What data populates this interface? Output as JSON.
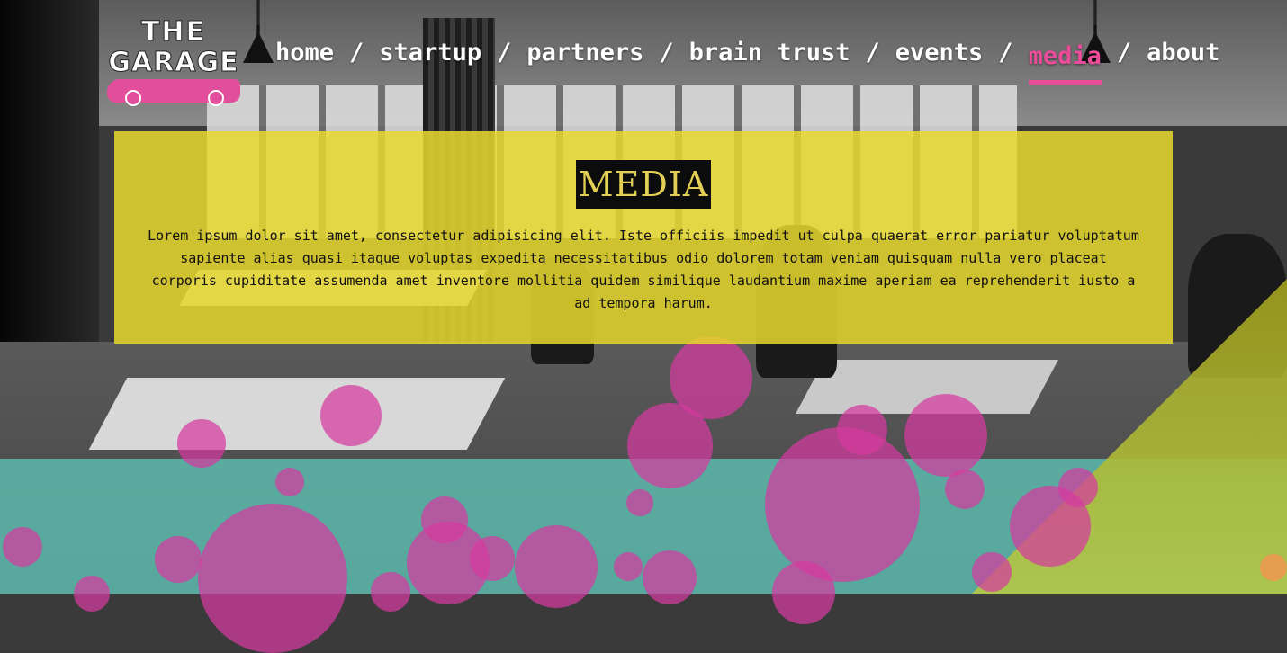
{
  "logo": {
    "line1": "THE",
    "line2": "GARAGE",
    "accent_color": "#e24e9b"
  },
  "nav": {
    "items": [
      {
        "label": "home",
        "active": false
      },
      {
        "label": "startup",
        "active": false
      },
      {
        "label": "partners",
        "active": false
      },
      {
        "label": "brain trust",
        "active": false
      },
      {
        "label": "events",
        "active": false
      },
      {
        "label": "media",
        "active": true
      },
      {
        "label": "about",
        "active": false
      }
    ],
    "separator": "/",
    "active_color": "#e84d9a",
    "text_color": "#ffffff"
  },
  "content": {
    "title": "MEDIA",
    "body": "Lorem ipsum dolor sit amet, consectetur adipisicing elit. Iste officiis impedit ut culpa quaerat error pariatur voluptatum sapiente alias quasi itaque voluptas expedita necessitatibus odio dolorem totam veniam quisquam nulla vero placeat corporis cupiditate assumenda amet inventore mollitia quidem similique laudantium maxime aperiam ea reprehenderit iusto a ad tempora harum.",
    "panel_color": "#e8d92e",
    "title_color": "#e3cf55"
  },
  "decor": {
    "bubble_color": "#d63aa0",
    "teal_band_color": "#5ec4b6",
    "olive_triangle_color": "#aaaa1e"
  }
}
